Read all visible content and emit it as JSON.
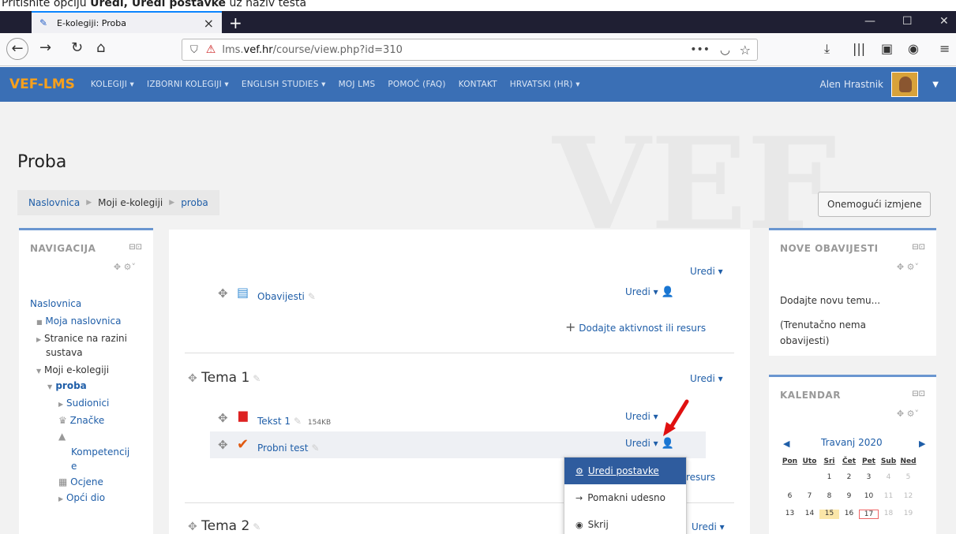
{
  "instruction": {
    "prefix": "Pritisnite opciju ",
    "bold": "Uredi, Uredi postavke",
    "suffix": " uz naziv testa"
  },
  "browser": {
    "tab_title": "E-kolegiji: Proba",
    "url_host": "lms.",
    "url_domain": "vef.hr",
    "url_path": "/course/view.php?id=310"
  },
  "navbar": {
    "brand": "VEF-LMS",
    "items": [
      "KOLEGIJI ▾",
      "IZBORNI KOLEGIJI ▾",
      "ENGLISH STUDIES ▾",
      "MOJ LMS",
      "POMOĆ (FAQ)",
      "KONTAKT",
      "HRVATSKI (HR) ▾"
    ],
    "user": "Alen Hrastnik"
  },
  "page": {
    "title": "Proba",
    "breadcrumb": [
      "Naslovnica",
      "Moji e-kolegiji",
      "proba"
    ],
    "edit_button": "Onemogući izmjene"
  },
  "nav_block": {
    "title": "NAVIGACIJA",
    "items": [
      "Naslovnica",
      "Moja naslovnica",
      "Stranice na razini",
      "sustava",
      "Moji e-kolegiji",
      "proba",
      "Sudionici",
      "Značke",
      "Kompetencij",
      "e",
      "Ocjene",
      "Opći dio"
    ]
  },
  "main": {
    "uredi": "Uredi ▾",
    "announcements": "Obavijesti",
    "add_activity": "Dodajte aktivnost ili resurs",
    "topic1": "Tema 1",
    "text1": "Tekst 1",
    "text1_size": "154KB",
    "quiz": "Probni test",
    "topic2": "Tema 2",
    "resurs_tail": "resurs"
  },
  "dropdown": {
    "items": [
      "Uredi postavke",
      "Pomakni udesno",
      "Skrij"
    ]
  },
  "news_block": {
    "title": "NOVE OBAVIJESTI",
    "add": "Dodajte novu temu...",
    "empty": "(Trenutačno nema obavijesti)"
  },
  "calendar": {
    "title": "KALENDAR",
    "month": "Travanj 2020",
    "days": [
      "Pon",
      "Uto",
      "Sri",
      "Čet",
      "Pet",
      "Sub",
      "Ned"
    ],
    "row1": [
      "",
      "",
      "1",
      "2",
      "3",
      "4",
      "5"
    ],
    "row2": [
      "6",
      "7",
      "8",
      "9",
      "10",
      "11",
      "12"
    ],
    "row3": [
      "13",
      "14",
      "15",
      "16",
      "17",
      "18",
      "19"
    ]
  }
}
